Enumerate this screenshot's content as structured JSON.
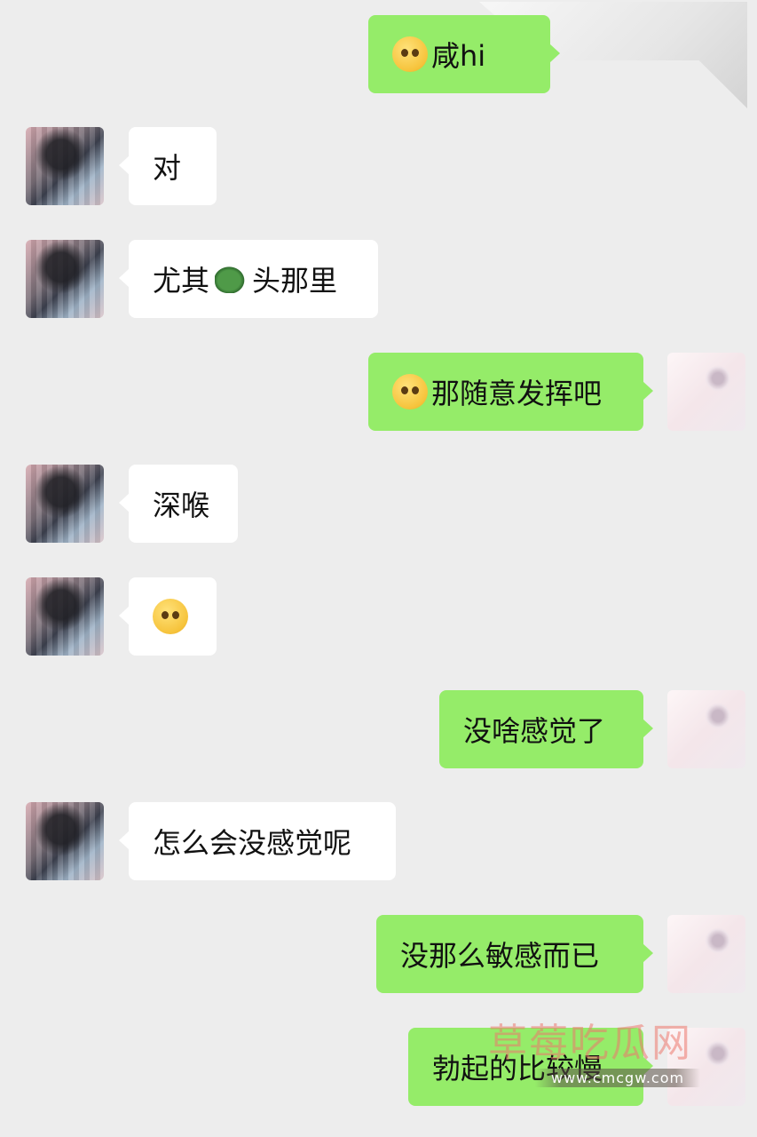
{
  "messages": [
    {
      "side": "right",
      "emoji": "emoji-pleading",
      "text": "咸hi"
    },
    {
      "side": "left",
      "text": "对"
    },
    {
      "side": "left",
      "text_before": "尤其",
      "emoji": "turtle-icon",
      "text_after": "头那里"
    },
    {
      "side": "right",
      "emoji": "emoji-sweat",
      "text": "那随意发挥吧"
    },
    {
      "side": "left",
      "text": "深喉"
    },
    {
      "side": "left",
      "emoji": "emoji-hug",
      "text": ""
    },
    {
      "side": "right",
      "text": "没啥感觉了"
    },
    {
      "side": "left",
      "text": "怎么会没感觉呢"
    },
    {
      "side": "right",
      "text": "没那么敏感而已"
    },
    {
      "side": "right",
      "text": "勃起的比较慢"
    }
  ],
  "watermark": {
    "title": "草莓吃瓜网",
    "url": "www.cmcgw.com"
  }
}
